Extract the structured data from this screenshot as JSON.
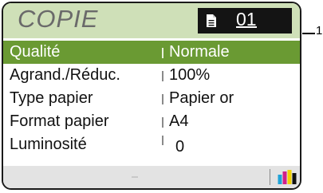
{
  "screen": {
    "title": "COPIE",
    "copies": "01"
  },
  "settings": [
    {
      "label": "Qualité",
      "value": "Normale"
    },
    {
      "label": "Agrand./Réduc.",
      "value": "100%"
    },
    {
      "label": "Type papier",
      "value": "Papier or"
    },
    {
      "label": "Format papier",
      "value": "A4"
    },
    {
      "label": "Luminosité",
      "value": "0"
    }
  ],
  "callout": {
    "number": "1"
  },
  "icons": {
    "document": "document-icon",
    "ink_levels": "ink-level-icon"
  },
  "colors": {
    "header_bg": "#cfe0b8",
    "selected_row": "#6a9a33",
    "copy_box": "#141414",
    "footer_bg": "#e3e3e3",
    "ink_cyan": "#1fa3d7",
    "ink_magenta": "#d11f8a",
    "ink_yellow": "#f2d200",
    "ink_black": "#111111"
  }
}
